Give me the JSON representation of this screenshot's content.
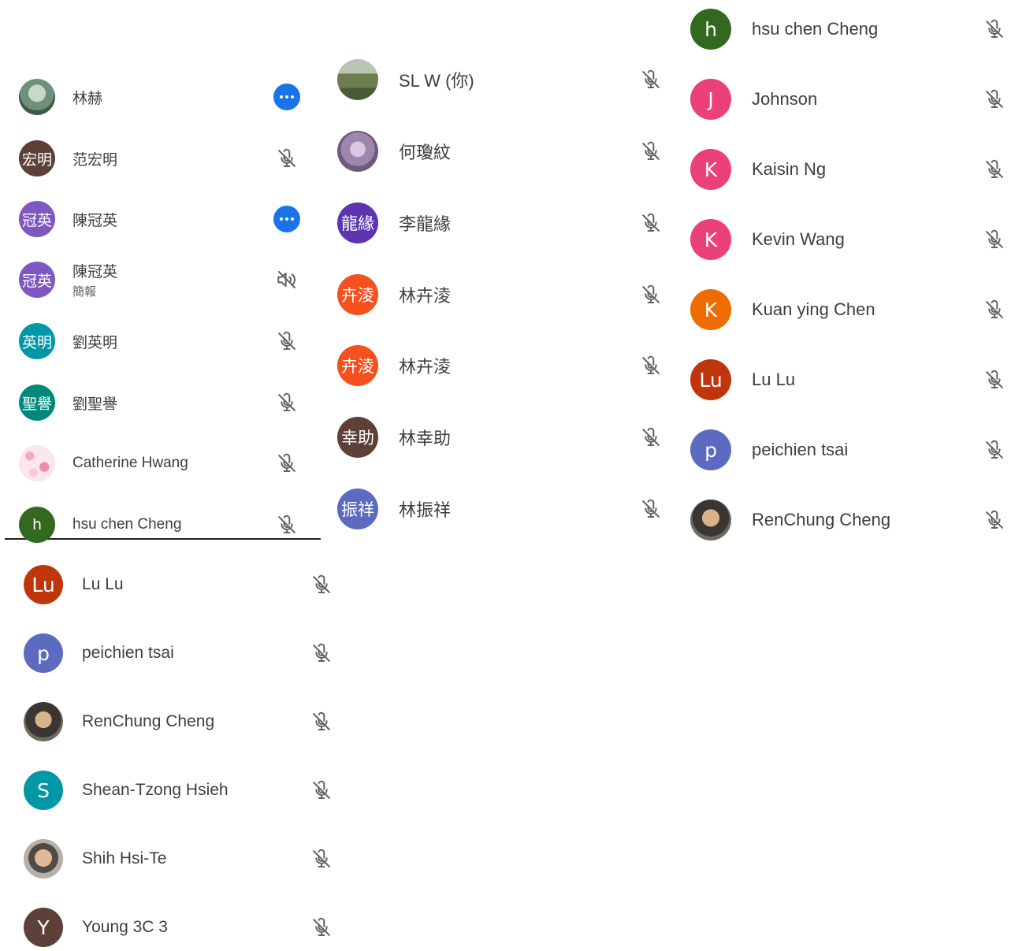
{
  "colors": {
    "icon_gray": "#5f6368",
    "more_button_blue": "#1a73e8",
    "text": "#3c4043"
  },
  "panel_a": {
    "participants": [
      {
        "name": "林赫",
        "avatar_text": "",
        "avatar_color": "#7a9a8a",
        "photo": true,
        "control": "more-options"
      },
      {
        "name": "范宏明",
        "avatar_text": "宏明",
        "avatar_color": "#5d4037",
        "control": "mic-off"
      },
      {
        "name": "陳冠英",
        "avatar_text": "冠英",
        "avatar_color": "#7e57c2",
        "control": "more-options"
      },
      {
        "name": "陳冠英",
        "subtitle": "簡報",
        "avatar_text": "冠英",
        "avatar_color": "#7e57c2",
        "control": "presentation-audio-off"
      },
      {
        "name": "劉英明",
        "avatar_text": "英明",
        "avatar_color": "#0097a7",
        "control": "mic-off"
      },
      {
        "name": "劉聖譽",
        "avatar_text": "聖譽",
        "avatar_color": "#00897b",
        "control": "mic-off"
      },
      {
        "name": "Catherine Hwang",
        "avatar_text": "",
        "avatar_color": "#f3c4d4",
        "photo": true,
        "control": "mic-off"
      },
      {
        "name": "hsu chen Cheng",
        "avatar_text": "h",
        "avatar_color": "#33691e",
        "control": "mic-off"
      }
    ]
  },
  "panel_b": {
    "participants": [
      {
        "name": "SL W (你)",
        "avatar_text": "",
        "avatar_color": "#6b7a4f",
        "photo": true,
        "control": "mic-off"
      },
      {
        "name": "何瓊紋",
        "avatar_text": "",
        "avatar_color": "#a88fb0",
        "photo": true,
        "control": "mic-off"
      },
      {
        "name": "李龍緣",
        "avatar_text": "龍緣",
        "avatar_color": "#5e35b1",
        "control": "mic-off"
      },
      {
        "name": "林卉淩",
        "avatar_text": "卉淩",
        "avatar_color": "#f4511e",
        "control": "mic-off"
      },
      {
        "name": "林卉淩",
        "avatar_text": "卉淩",
        "avatar_color": "#f4511e",
        "control": "mic-off"
      },
      {
        "name": "林幸助",
        "avatar_text": "幸助",
        "avatar_color": "#5d4037",
        "control": "mic-off"
      },
      {
        "name": "林振祥",
        "avatar_text": "振祥",
        "avatar_color": "#5c6bc0",
        "control": "mic-off"
      }
    ]
  },
  "panel_c": {
    "participants": [
      {
        "name": "hsu chen Cheng",
        "avatar_text": "h",
        "avatar_color": "#33691e",
        "control": "mic-off"
      },
      {
        "name": "Johnson",
        "avatar_text": "J",
        "avatar_color": "#ec407a",
        "control": "mic-off"
      },
      {
        "name": "Kaisin Ng",
        "avatar_text": "K",
        "avatar_color": "#ec407a",
        "control": "mic-off"
      },
      {
        "name": "Kevin Wang",
        "avatar_text": "K",
        "avatar_color": "#ec407a",
        "control": "mic-off"
      },
      {
        "name": "Kuan ying Chen",
        "avatar_text": "K",
        "avatar_color": "#ef6c00",
        "control": "mic-off"
      },
      {
        "name": "Lu Lu",
        "avatar_text": "Lu",
        "avatar_color": "#bf360c",
        "control": "mic-off"
      },
      {
        "name": "peichien tsai",
        "avatar_text": "p",
        "avatar_color": "#5c6bc0",
        "control": "mic-off"
      },
      {
        "name": "RenChung Cheng",
        "avatar_text": "",
        "avatar_color": "#4e4a44",
        "photo": true,
        "control": "mic-off"
      }
    ]
  },
  "panel_d": {
    "participants": [
      {
        "name": "Lu Lu",
        "avatar_text": "Lu",
        "avatar_color": "#bf360c",
        "control": "mic-off"
      },
      {
        "name": "peichien tsai",
        "avatar_text": "p",
        "avatar_color": "#5c6bc0",
        "control": "mic-off"
      },
      {
        "name": "RenChung Cheng",
        "avatar_text": "",
        "avatar_color": "#4e4a44",
        "photo": true,
        "control": "mic-off"
      },
      {
        "name": "Shean-Tzong Hsieh",
        "avatar_text": "S",
        "avatar_color": "#0097a7",
        "control": "mic-off"
      },
      {
        "name": "Shih Hsi-Te",
        "avatar_text": "",
        "avatar_color": "#8d7a6a",
        "photo": true,
        "control": "mic-off"
      },
      {
        "name": "Young 3C 3",
        "avatar_text": "Y",
        "avatar_color": "#5d4037",
        "control": "mic-off"
      }
    ]
  }
}
